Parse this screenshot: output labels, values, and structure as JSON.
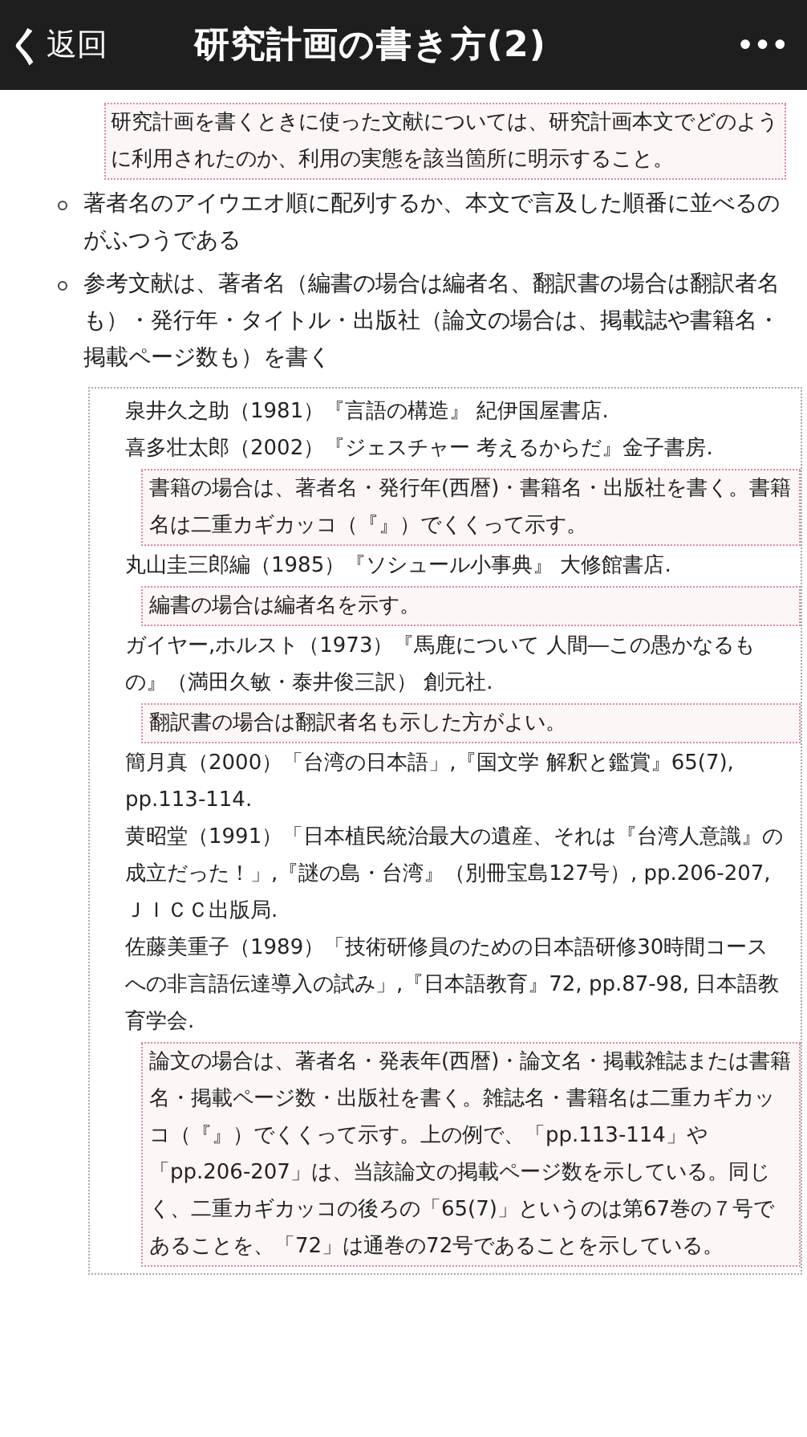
{
  "header": {
    "back_icon": "く",
    "back_label": "返回",
    "title": "研究計画の書き方(2)",
    "more": "•••"
  },
  "note": "研究計画を書くときに使った文献については、研究計画本文でどのように利用されたのか、利用の実態を該当箇所に明示すること。",
  "bullets": [
    "著者名のアイウエオ順に配列するか、本文で言及した順番に並べるのがふつうである",
    "参考文献は、著者名（編書の場合は編者名、翻訳書の場合は翻訳者名も）・発行年・タイトル・出版社（論文の場合は、掲載誌や書籍名・掲載ページ数も）を書く"
  ],
  "references": [
    {
      "kind": "reference",
      "text": "泉井久之助（1981）『言語の構造』 紀伊国屋書店."
    },
    {
      "kind": "reference",
      "text": "喜多壮太郎（2002）『ジェスチャー 考えるからだ』金子書房."
    },
    {
      "kind": "note",
      "text": "書籍の場合は、著者名・発行年(西暦)・書籍名・出版社を書く。書籍名は二重カギカッコ（『』）でくくって示す。"
    },
    {
      "kind": "reference",
      "text": "丸山圭三郎編（1985）『ソシュール小事典』 大修館書店."
    },
    {
      "kind": "note",
      "text": "編書の場合は編者名を示す。"
    },
    {
      "kind": "reference",
      "text": "ガイヤー,ホルスト（1973）『馬鹿について 人間―この愚かなるもの』（満田久敏・泰井俊三訳） 創元社."
    },
    {
      "kind": "note",
      "text": "翻訳書の場合は翻訳者名も示した方がよい。"
    },
    {
      "kind": "reference",
      "text": "簡月真（2000）「台湾の日本語」,『国文学 解釈と鑑賞』65(7), pp.113-114."
    },
    {
      "kind": "reference",
      "text": "黄昭堂（1991）「日本植民統治最大の遺産、それは『台湾人意識』の成立だった！」,『謎の島・台湾』（別冊宝島127号）, pp.206-207, ＪＩＣＣ出版局."
    },
    {
      "kind": "reference",
      "text": "佐藤美重子（1989）「技術研修員のための日本語研修30時間コースへの非言語伝達導入の試み」,『日本語教育』72, pp.87-98, 日本語教育学会."
    },
    {
      "kind": "note",
      "text": "論文の場合は、著者名・発表年(西暦)・論文名・掲載雑誌または書籍名・掲載ページ数・出版社を書く。雑誌名・書籍名は二重カギカッコ（『』）でくくって示す。上の例で、「pp.113-114」や「pp.206-207」は、当該論文の掲載ページ数を示している。同じく、二重カギカッコの後ろの「65(7)」というのは第67巻の７号であることを、「72」は通巻の72号であることを示している。"
    }
  ]
}
